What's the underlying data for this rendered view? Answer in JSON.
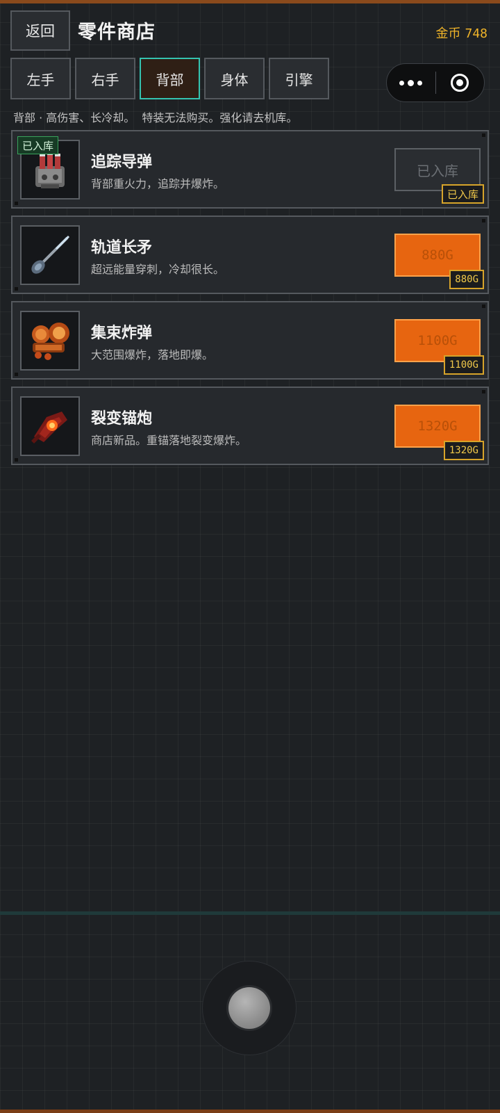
{
  "header": {
    "back_label": "返回",
    "title": "零件商店",
    "gold_label": "金币",
    "gold_value": "748"
  },
  "tabs": [
    {
      "label": "左手",
      "active": false
    },
    {
      "label": "右手",
      "active": false
    },
    {
      "label": "背部",
      "active": true
    },
    {
      "label": "身体",
      "active": false
    },
    {
      "label": "引擎",
      "active": false
    }
  ],
  "description": "背部 · 高伤害、长冷却。  特装无法购买。强化请去机库。",
  "items": [
    {
      "name": "追踪导弹",
      "desc": "背部重火力，追踪并爆炸。",
      "stored_tag": "已入库",
      "button": "已入库",
      "tag": "已入库",
      "owned": true,
      "icon": "missile-pod-icon"
    },
    {
      "name": "轨道长矛",
      "desc": "超远能量穿刺，冷却很长。",
      "button": "880G",
      "tag": "880G",
      "owned": false,
      "icon": "lance-icon"
    },
    {
      "name": "集束炸弹",
      "desc": "大范围爆炸，落地即爆。",
      "button": "1100G",
      "tag": "1100G",
      "owned": false,
      "icon": "cluster-bomb-icon"
    },
    {
      "name": "裂变锚炮",
      "desc": "商店新品。重锚落地裂变爆炸。",
      "button": "1320G",
      "tag": "1320G",
      "owned": false,
      "icon": "anchor-cannon-icon"
    }
  ],
  "colors": {
    "accent": "#34c3b0",
    "orange": "#e76510",
    "gold": "#f0b429",
    "stored_green": "#39a35c"
  }
}
